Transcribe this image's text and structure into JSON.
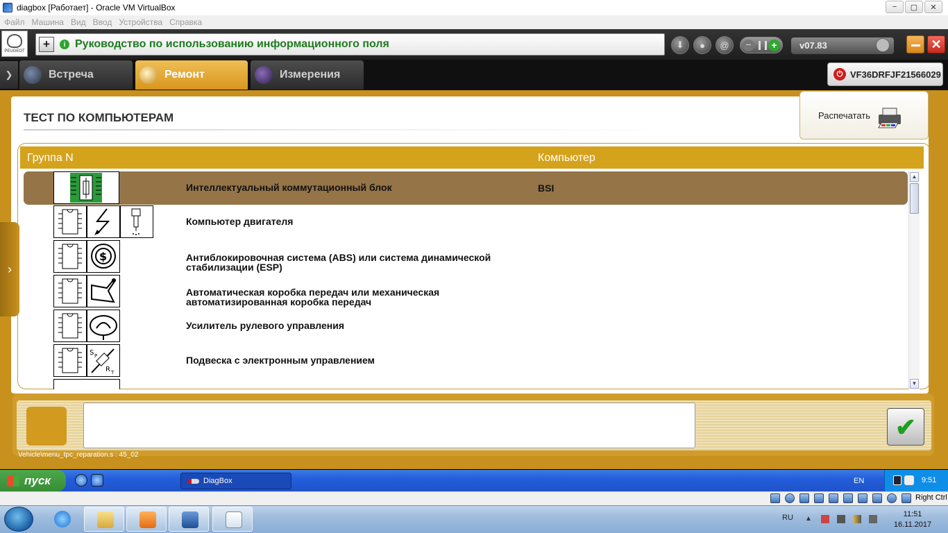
{
  "window": {
    "title": "diagbox [Работает] - Oracle VM VirtualBox",
    "controls": [
      "−",
      "▢",
      "✕"
    ]
  },
  "menubar": [
    "Файл",
    "Машина",
    "Вид",
    "Ввод",
    "Устройства",
    "Справка"
  ],
  "app_header": {
    "logo_text": "PEUGEOT",
    "title": "Руководство по использованию информационного поля",
    "version": "v07.83",
    "icons": [
      "download-icon",
      "user-icon",
      "at-icon",
      "signal-toggle",
      "minimize-icon",
      "close-icon"
    ]
  },
  "tabs": [
    {
      "label": "Встреча",
      "active": false
    },
    {
      "label": "Ремонт",
      "active": true
    },
    {
      "label": "Измерения",
      "active": false
    }
  ],
  "vin": "VF36DRFJF21566029",
  "page": {
    "title": "ТЕСТ ПО КОМПЬЮТЕРАМ",
    "print_label": "Распечатать"
  },
  "table": {
    "headers": {
      "group": "Группа N",
      "computer": "Компьютер"
    },
    "rows": [
      {
        "name": "Интеллектуальный коммутационный блок",
        "code": "BSI",
        "selected": true
      },
      {
        "name": "Компьютер двигателя",
        "code": "",
        "selected": false
      },
      {
        "name_line1": "Антиблокировочная система (ABS) или система динамической",
        "name_line2": "стабилизации (ESP)",
        "code": "",
        "selected": false
      },
      {
        "name_line1": "Автоматическая коробка передач или механическая",
        "name_line2": "автоматизированная коробка передач",
        "code": "",
        "selected": false
      },
      {
        "name": "Усилитель рулевого управления",
        "code": "",
        "selected": false
      },
      {
        "name": "Подвеска с электронным управлением",
        "code": "",
        "selected": false
      }
    ]
  },
  "footer": {
    "path": "Vehicle\\menu_tpc_reparation.s : 45_02",
    "ok_symbol": "✔"
  },
  "guest_taskbar": {
    "start": "пуск",
    "task": "DiagBox",
    "lang": "EN",
    "time": "9:51"
  },
  "vbox_status": {
    "host_key": "Right Ctrl"
  },
  "host_taskbar": {
    "lang": "RU",
    "time": "11:51",
    "date": "16.11.2017"
  }
}
